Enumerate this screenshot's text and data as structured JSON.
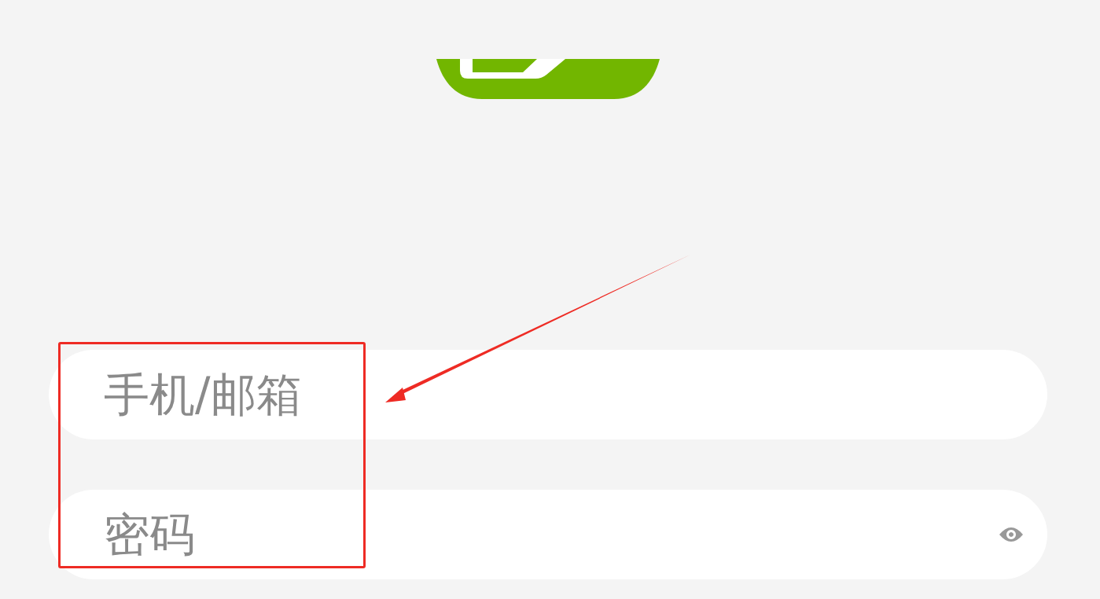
{
  "logo": {
    "color": "#72b600"
  },
  "fields": [
    {
      "placeholder": "手机/邮箱",
      "show_toggle": false
    },
    {
      "placeholder": "密码",
      "show_toggle": true
    }
  ],
  "annotations": {
    "highlight_box": {
      "color": "#ee2b24"
    },
    "arrow": {
      "color": "#ee2b24"
    }
  }
}
